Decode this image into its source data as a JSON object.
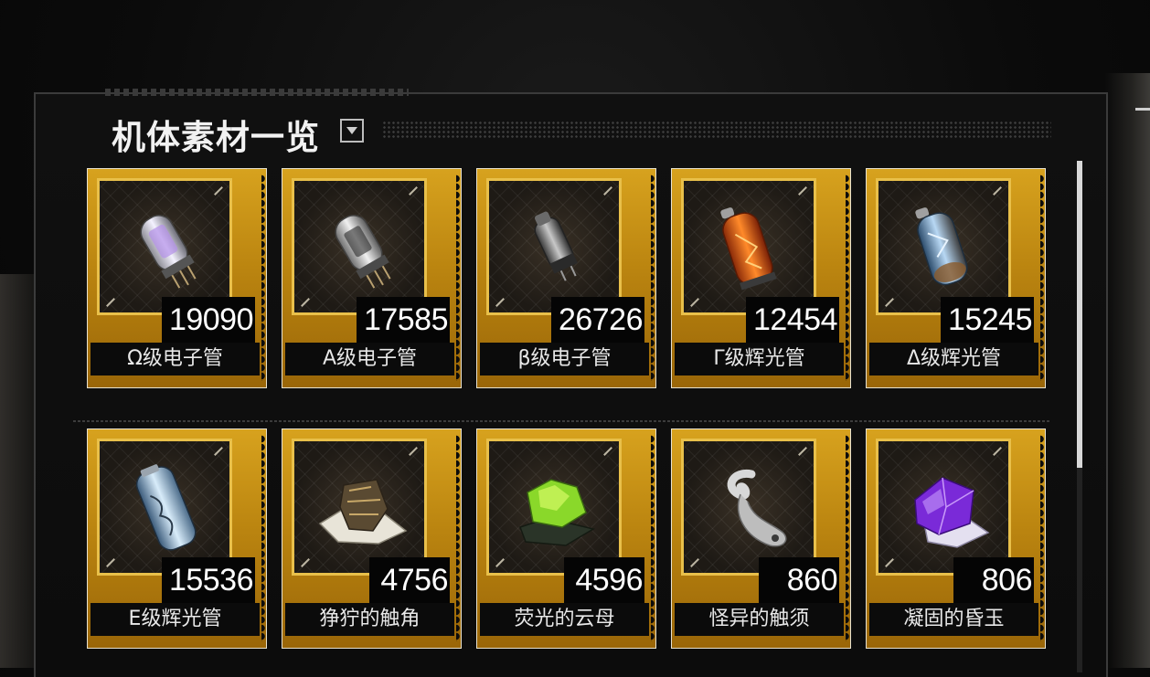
{
  "panel": {
    "title": "机体素材一览"
  },
  "materials": [
    {
      "count": "19090",
      "name": "Ω级电子管",
      "icon": "electron-tube-purple-icon"
    },
    {
      "count": "17585",
      "name": "Α级电子管",
      "icon": "electron-tube-silver-icon"
    },
    {
      "count": "26726",
      "name": "β级电子管",
      "icon": "electron-tube-dark-icon"
    },
    {
      "count": "12454",
      "name": "Γ级辉光管",
      "icon": "glow-tube-orange-icon"
    },
    {
      "count": "15245",
      "name": "Δ级辉光管",
      "icon": "glow-tube-blue-icon"
    },
    {
      "count": "15536",
      "name": "Ε级辉光管",
      "icon": "glow-tube-ice-icon"
    },
    {
      "count": "4756",
      "name": "狰狞的触角",
      "icon": "horn-fragment-icon"
    },
    {
      "count": "4596",
      "name": "荧光的云母",
      "icon": "green-mica-icon"
    },
    {
      "count": "860",
      "name": "怪异的触须",
      "icon": "silver-tentacle-icon"
    },
    {
      "count": "806",
      "name": "凝固的昏玉",
      "icon": "purple-crystal-icon"
    }
  ],
  "colors": {
    "card_gold": "#c8921a",
    "frame_gold": "#e9c04a",
    "count_bg": "#050505"
  }
}
